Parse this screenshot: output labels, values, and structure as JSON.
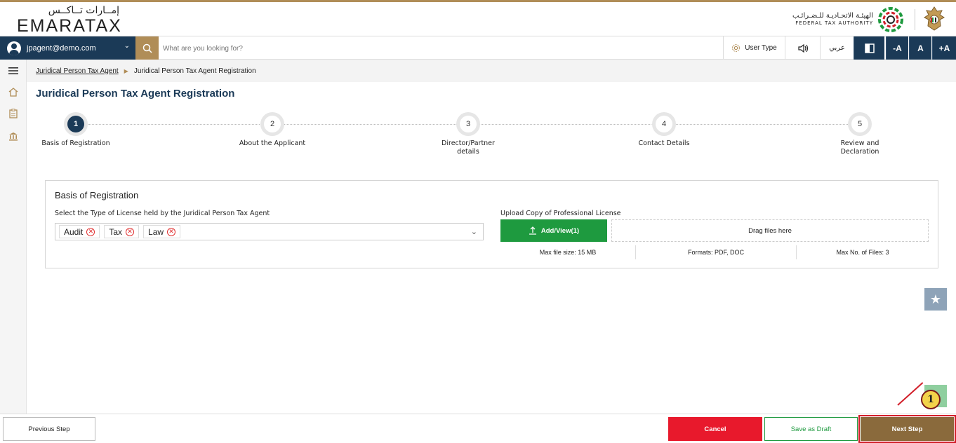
{
  "brand": {
    "logo_ar": "إمــارات تــاكــس",
    "logo_en": "EMARATAX",
    "fta_ar": "الهيئـة الاتحـاديـة للـضـرائـب",
    "fta_en": "FEDERAL TAX AUTHORITY",
    "accent_color": "#b08d57",
    "navy_color": "#1b3a57"
  },
  "topbar": {
    "user_email": "jpagent@demo.com",
    "search_placeholder": "What are you looking for?",
    "user_type_label": "User Type",
    "language_label": "عربي",
    "font_decrease": "-A",
    "font_normal": "A",
    "font_increase": "+A"
  },
  "breadcrumb": {
    "parent": "Juridical Person Tax Agent",
    "current": "Juridical Person Tax Agent Registration"
  },
  "page": {
    "title": "Juridical Person Tax Agent Registration"
  },
  "stepper": {
    "current_step": 1,
    "steps": [
      {
        "number": "1",
        "label": "Basis of Registration"
      },
      {
        "number": "2",
        "label": "About the Applicant"
      },
      {
        "number": "3",
        "label": "Director/Partner details"
      },
      {
        "number": "4",
        "label": "Contact Details"
      },
      {
        "number": "5",
        "label": "Review and Declaration"
      }
    ]
  },
  "form": {
    "section_title": "Basis of Registration",
    "license_type_label": "Select the Type of License held by the Juridical Person Tax Agent",
    "selected_licenses": [
      "Audit",
      "Tax",
      "Law"
    ],
    "upload_label": "Upload Copy of Professional License",
    "upload_button": "Add/View(1)",
    "drop_text": "Drag files here",
    "max_size": "Max file size: 15 MB",
    "formats": "Formats: PDF, DOC",
    "max_files": "Max No. of Files: 3"
  },
  "footer": {
    "previous": "Previous Step",
    "cancel": "Cancel",
    "save_draft": "Save as Draft",
    "next": "Next Step"
  },
  "annotation": {
    "callout_number": "1"
  }
}
